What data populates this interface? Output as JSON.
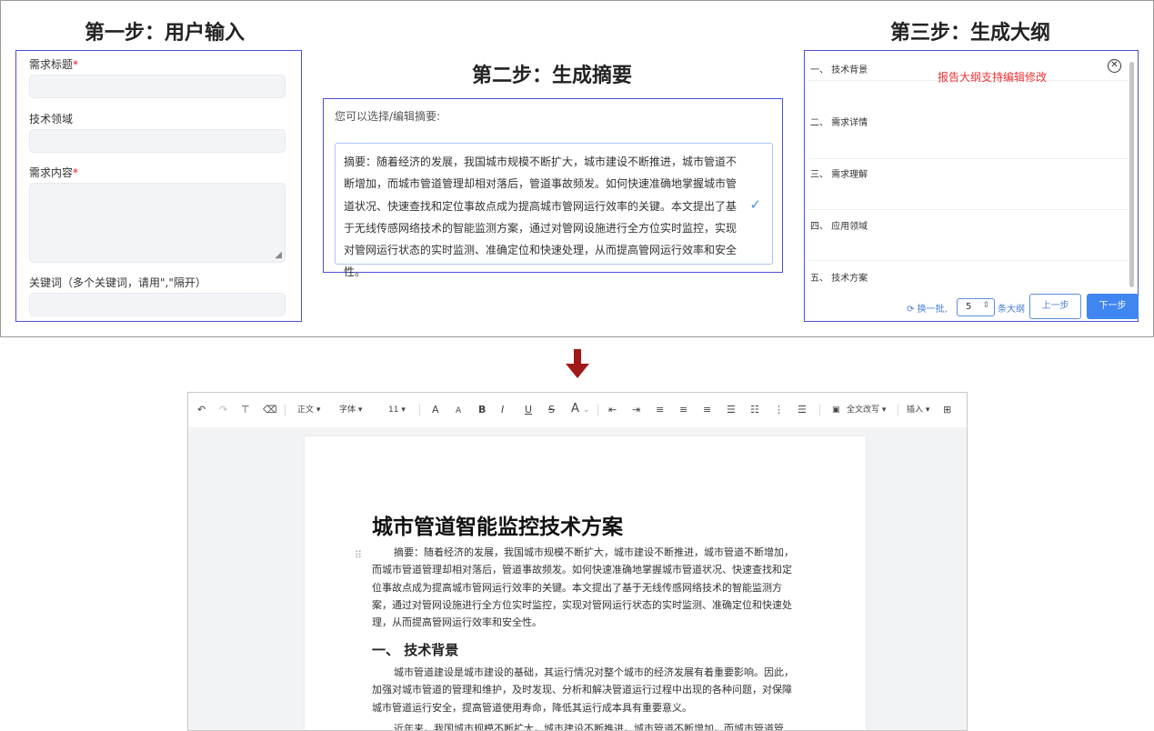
{
  "step1": {
    "title": "第一步：用户输入",
    "fields": [
      {
        "label": "需求标题",
        "required": "*"
      },
      {
        "label": "技术领域"
      },
      {
        "label": "需求内容",
        "required": "*"
      },
      {
        "label": "关键词（多个关键词，请用\",\"隔开）"
      }
    ]
  },
  "step2": {
    "title": "第二步：生成摘要",
    "prompt": "您可以选择/编辑摘要:",
    "summary": "摘要：随着经济的发展，我国城市规模不断扩大，城市建设不断推进，城市管道不断增加，而城市管道管理却相对落后，管道事故频发。如何快速准确地掌握城市管道状况、快速查找和定位事故点成为提高城市管网运行效率的关键。本文提出了基于无线传感网络技术的智能监测方案，通过对管网设施进行全方位实时监控，实现对管网运行状态的实时监测、准确定位和快速处理，从而提高管网运行效率和安全性。",
    "check_icon": "checkmark-icon"
  },
  "step3": {
    "title": "第三步：生成大纲",
    "note": "报告大纲支持编辑修改",
    "items": [
      "一、 技术背景",
      "二、 需求详情",
      "三、 需求理解",
      "四、 应用领域",
      "五、 技术方案"
    ],
    "refresh_label": "换一批,",
    "count": "5",
    "count_suffix": "条大纲",
    "prev_label": "上一步",
    "next_label": "下一步"
  },
  "editor": {
    "toolbar": {
      "undo": "↶",
      "redo": "↷",
      "format_painter": "⊤",
      "clear_format": "⌫",
      "paragraph_style": "正文 ▾",
      "font_family": "字体 ▾",
      "font_size": "11 ▾",
      "font_grow": "A",
      "font_shrink": "A",
      "bold": "B",
      "italic": "I",
      "underline": "U",
      "strikethrough": "S",
      "font_color": "A",
      "rewrite_all": "全文改写 ▾",
      "insert": "插入 ▾"
    },
    "doc": {
      "title": "城市管道智能监控技术方案",
      "abstract": "摘要：随着经济的发展，我国城市规模不断扩大，城市建设不断推进，城市管道不断增加，而城市管道管理却相对落后，管道事故频发。如何快速准确地掌握城市管道状况、快速查找和定位事故点成为提高城市管网运行效率的关键。本文提出了基于无线传感网络技术的智能监测方案，通过对管网设施进行全方位实时监控，实现对管网运行状态的实时监测、准确定位和快速处理，从而提高管网运行效率和安全性。",
      "section1_heading": "一、  技术背景",
      "section1_p1": "城市管道建设是城市建设的基础，其运行情况对整个城市的经济发展有着重要影响。因此，加强对城市管道的管理和维护，及时发现、分析和解决管道运行过程中出现的各种问题，对保障城市管道运行安全，提高管道使用寿命，降低其运行成本具有重要意义。",
      "section1_p2": "近年来，我国城市规模不断扩大，城市建设不断推进，城市管道不断增加，而城市管道管"
    }
  },
  "colors": {
    "accent_border": "#4a4fe0",
    "primary_button": "#3f86f0",
    "required": "#e02020",
    "note": "#ee3333",
    "arrow": "#a01818"
  }
}
